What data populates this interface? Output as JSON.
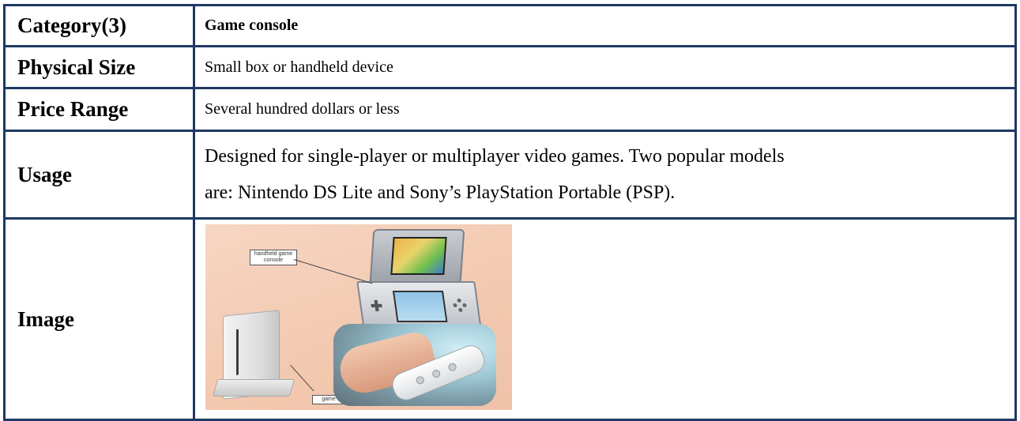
{
  "rows": [
    {
      "key": "Category(3)",
      "value": "Game console"
    },
    {
      "key": "Physical Size",
      "value": "Small box or handheld device"
    },
    {
      "key": "Price Range",
      "value": "Several hundred dollars or less"
    },
    {
      "key": "Usage",
      "value_line1": "Designed for single-player or multiplayer video games. Two popular models",
      "value_line2": "are: Nintendo DS Lite and Sony’s PlayStation Portable (PSP)."
    },
    {
      "key": "Image"
    }
  ],
  "image_labels": {
    "handheld": "handheld game console",
    "console": "game console"
  },
  "colors": {
    "border": "#1f3864",
    "photo_background": "#f3c9b1"
  }
}
